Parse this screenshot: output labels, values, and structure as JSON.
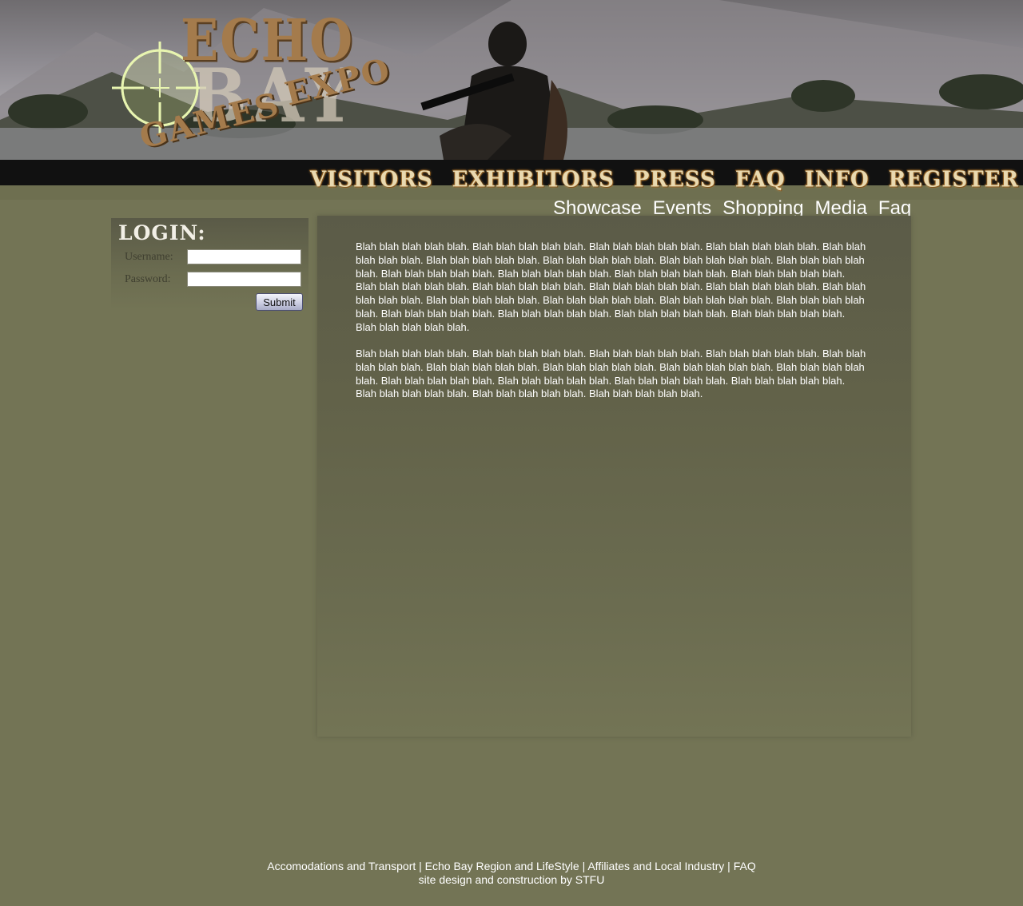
{
  "logo": {
    "line1": "ECHO",
    "line2": "BAY",
    "line3": "GAMES",
    "line4": "EXPO"
  },
  "topnav": [
    "VISITORS",
    "EXHIBITORS",
    "PRESS",
    "FAQ",
    "INFO",
    "REGISTER"
  ],
  "subnav": [
    "Showcase",
    "Events",
    "Shopping",
    "Media",
    "Faq"
  ],
  "login": {
    "title": "LOGIN:",
    "username_label": "Username:",
    "password_label": "Password:",
    "username_value": "",
    "password_value": "",
    "submit_label": "Submit"
  },
  "content": {
    "paragraph1": "Blah blah blah blah blah. Blah blah blah blah blah. Blah blah blah blah blah. Blah blah blah blah blah. Blah blah blah blah blah. Blah blah blah blah blah. Blah blah blah blah blah. Blah blah blah blah blah. Blah blah blah blah blah. Blah blah blah blah blah. Blah blah blah blah blah. Blah blah blah blah blah. Blah blah blah blah blah. Blah blah blah blah blah. Blah blah blah blah blah. Blah blah blah blah blah. Blah blah blah blah blah. Blah blah blah blah blah. Blah blah blah blah blah. Blah blah blah blah blah. Blah blah blah blah blah. Blah blah blah blah blah. Blah blah blah blah blah. Blah blah blah blah blah. Blah blah blah blah blah. Blah blah blah blah blah. Blah blah blah blah blah.",
    "paragraph2": "Blah blah blah blah blah. Blah blah blah blah blah. Blah blah blah blah blah. Blah blah blah blah blah. Blah blah blah blah blah. Blah blah blah blah blah. Blah blah blah blah blah. Blah blah blah blah blah. Blah blah blah blah blah. Blah blah blah blah blah. Blah blah blah blah blah. Blah blah blah blah blah. Blah blah blah blah blah. Blah blah blah blah blah. Blah blah blah blah blah. Blah blah blah blah blah."
  },
  "footer": {
    "links": [
      "Accomodations and Transport",
      "Echo Bay Region and LifeStyle",
      "Affiliates and Local Industry",
      "FAQ"
    ],
    "separator": " | ",
    "credit": "site design and construction by STFU"
  }
}
